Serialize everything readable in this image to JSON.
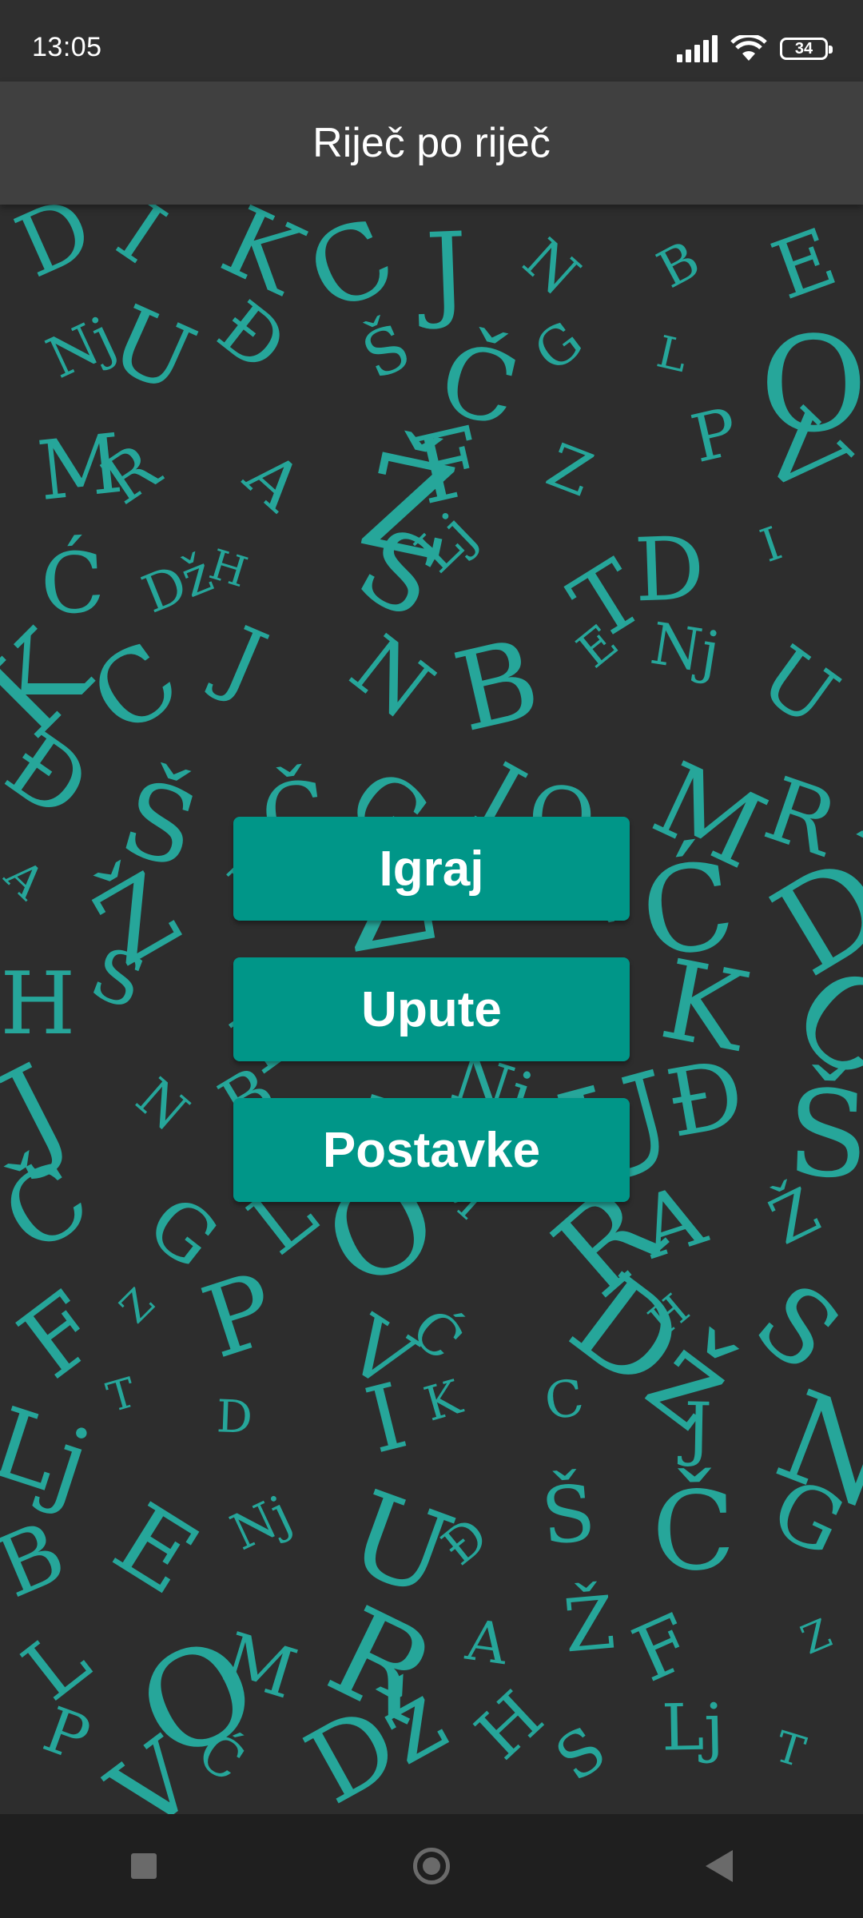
{
  "status_bar": {
    "time": "13:05",
    "battery": "34",
    "icons": [
      "signal-icon",
      "wifi-icon",
      "battery-icon"
    ]
  },
  "app_bar": {
    "title": "Riječ po riječ"
  },
  "menu": {
    "play_label": "Igraj",
    "instructions_label": "Upute",
    "settings_label": "Postavke"
  },
  "nav_bar": {
    "icons": [
      "recent-apps-icon",
      "home-icon",
      "back-icon"
    ]
  },
  "colors": {
    "accent": "#009688",
    "letters": "#26a69a",
    "background": "#2d2d2d",
    "app_bar": "#404040"
  },
  "background_letters": [
    "D",
    "I",
    "K",
    "C",
    "J",
    "N",
    "B",
    "E",
    "Nj",
    "U",
    "Đ",
    "Š",
    "Č",
    "G",
    "L",
    "O",
    "M",
    "R",
    "A",
    "Ž",
    "F",
    "Z",
    "P",
    "V",
    "Ć",
    "Dž",
    "H",
    "S",
    "Lj",
    "T",
    "D",
    "I",
    "K",
    "C",
    "J",
    "N",
    "B",
    "E",
    "Nj",
    "U",
    "Đ",
    "Š",
    "Č",
    "G",
    "L",
    "O",
    "M",
    "R",
    "A",
    "Ž",
    "F",
    "Z",
    "P",
    "V",
    "Ć",
    "Dž",
    "H",
    "S",
    "Lj",
    "T",
    "D",
    "I",
    "K",
    "C",
    "J",
    "N",
    "B",
    "E",
    "Nj",
    "U",
    "Đ",
    "Š",
    "Č",
    "G",
    "L",
    "O",
    "M",
    "R",
    "A",
    "Ž",
    "F",
    "Z",
    "P",
    "V",
    "Ć",
    "Dž",
    "H",
    "S",
    "Lj",
    "T",
    "D",
    "I",
    "K",
    "C",
    "J",
    "N",
    "B",
    "E",
    "Nj",
    "U",
    "Đ",
    "Š",
    "Č",
    "G",
    "L",
    "O",
    "M",
    "R",
    "A",
    "Ž",
    "F",
    "Z",
    "P",
    "V",
    "Ć",
    "Dž",
    "H",
    "S",
    "Lj",
    "T"
  ]
}
